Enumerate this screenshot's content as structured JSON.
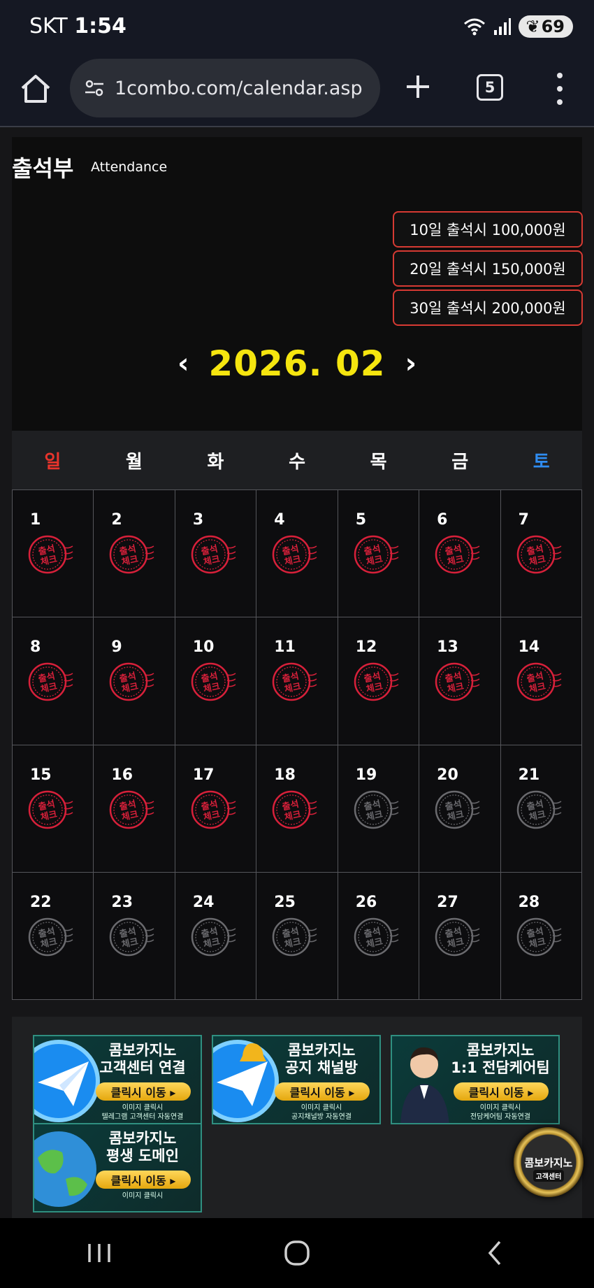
{
  "status": {
    "carrier": "SKT",
    "time": "1:54",
    "battery": "69"
  },
  "browser": {
    "url": "1combo.com/calendar.asp",
    "tab_count": "5"
  },
  "page": {
    "title": "출석부",
    "subtitle": "Attendance"
  },
  "rewards": [
    "10일 출석시 100,000원",
    "20일 출석시 150,000원",
    "30일 출석시 200,000원"
  ],
  "calendar": {
    "month_label": "2026. 02",
    "weekdays": [
      "일",
      "월",
      "화",
      "수",
      "목",
      "금",
      "토"
    ],
    "weekday_colors": [
      "#e8342c",
      "#ffffff",
      "#ffffff",
      "#ffffff",
      "#ffffff",
      "#ffffff",
      "#2f8cf0"
    ],
    "stamp_text": [
      "출석",
      "체크"
    ],
    "days": [
      {
        "n": "1",
        "checked": true
      },
      {
        "n": "2",
        "checked": true
      },
      {
        "n": "3",
        "checked": true
      },
      {
        "n": "4",
        "checked": true
      },
      {
        "n": "5",
        "checked": true
      },
      {
        "n": "6",
        "checked": true
      },
      {
        "n": "7",
        "checked": true
      },
      {
        "n": "8",
        "checked": true
      },
      {
        "n": "9",
        "checked": true
      },
      {
        "n": "10",
        "checked": true
      },
      {
        "n": "11",
        "checked": true
      },
      {
        "n": "12",
        "checked": true
      },
      {
        "n": "13",
        "checked": true
      },
      {
        "n": "14",
        "checked": true
      },
      {
        "n": "15",
        "checked": true
      },
      {
        "n": "16",
        "checked": true
      },
      {
        "n": "17",
        "checked": true
      },
      {
        "n": "18",
        "checked": true
      },
      {
        "n": "19",
        "checked": false
      },
      {
        "n": "20",
        "checked": false
      },
      {
        "n": "21",
        "checked": false
      },
      {
        "n": "22",
        "checked": false
      },
      {
        "n": "23",
        "checked": false
      },
      {
        "n": "24",
        "checked": false
      },
      {
        "n": "25",
        "checked": false
      },
      {
        "n": "26",
        "checked": false
      },
      {
        "n": "27",
        "checked": false
      },
      {
        "n": "28",
        "checked": false
      }
    ]
  },
  "banners": [
    {
      "title1": "콤보카지노",
      "title2": "고객센터 연결",
      "button": "클릭시 이동 ▸",
      "note1": "이미지 클릭시",
      "note2": "텔레그램 고객센터 자동연결"
    },
    {
      "title1": "콤보카지노",
      "title2": "공지 채널방",
      "button": "클릭시 이동 ▸",
      "note1": "이미지 클릭시",
      "note2": "공지채널방 자동연결"
    },
    {
      "title1": "콤보카지노",
      "title2": "1:1 전담케어팀",
      "button": "클릭시 이동 ▸",
      "note1": "이미지 클릭시",
      "note2": "전담케어팀 자동연결"
    },
    {
      "title1": "콤보카지노",
      "title2": "평생 도메인",
      "button": "클릭시 이동 ▸",
      "note1": "이미지 클릭시",
      "note2": ""
    }
  ],
  "cs_badge": {
    "line1": "콤보카지노",
    "line2": "고객센터"
  }
}
